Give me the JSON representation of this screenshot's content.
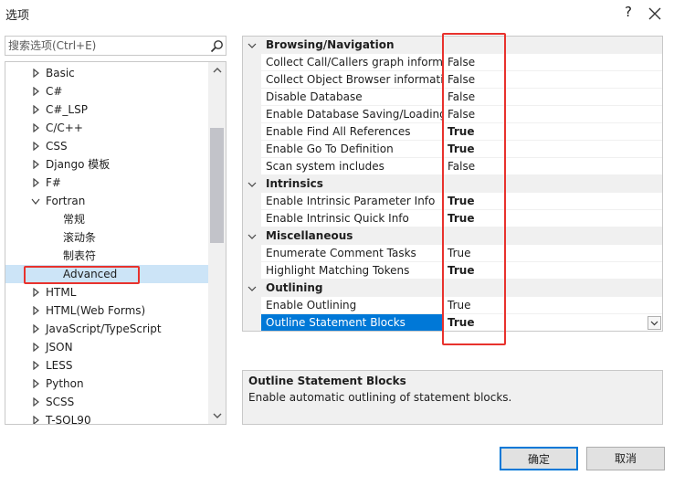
{
  "window": {
    "title": "选项",
    "help_label": "?"
  },
  "search": {
    "placeholder": "搜索选项(Ctrl+E)"
  },
  "tree": {
    "items": [
      {
        "label": "Basic",
        "expandable": true
      },
      {
        "label": "C#",
        "expandable": true
      },
      {
        "label": "C#_LSP",
        "expandable": true
      },
      {
        "label": "C/C++",
        "expandable": true
      },
      {
        "label": "CSS",
        "expandable": true
      },
      {
        "label": "Django 模板",
        "expandable": true
      },
      {
        "label": "F#",
        "expandable": true
      },
      {
        "label": "Fortran",
        "expandable": true,
        "expanded": true
      },
      {
        "label": "常规",
        "child": true
      },
      {
        "label": "滚动条",
        "child": true
      },
      {
        "label": "制表符",
        "child": true
      },
      {
        "label": "Advanced",
        "child": true,
        "selected": true
      },
      {
        "label": "HTML",
        "expandable": true
      },
      {
        "label": "HTML(Web Forms)",
        "expandable": true
      },
      {
        "label": "JavaScript/TypeScript",
        "expandable": true
      },
      {
        "label": "JSON",
        "expandable": true
      },
      {
        "label": "LESS",
        "expandable": true
      },
      {
        "label": "Python",
        "expandable": true
      },
      {
        "label": "SCSS",
        "expandable": true
      },
      {
        "label": "T-SQL90",
        "expandable": true
      }
    ]
  },
  "grid": {
    "categories": [
      {
        "label": "Browsing/Navigation",
        "props": [
          {
            "name": "Collect Call/Callers graph informa",
            "value": "False",
            "bold": false
          },
          {
            "name": "Collect Object Browser informatio",
            "value": "False",
            "bold": false
          },
          {
            "name": "Disable Database",
            "value": "False",
            "bold": false
          },
          {
            "name": "Enable Database Saving/Loading",
            "value": "False",
            "bold": false
          },
          {
            "name": "Enable Find All References",
            "value": "True",
            "bold": true
          },
          {
            "name": "Enable Go To Definition",
            "value": "True",
            "bold": true
          },
          {
            "name": "Scan system includes",
            "value": "False",
            "bold": false
          }
        ]
      },
      {
        "label": "Intrinsics",
        "props": [
          {
            "name": "Enable Intrinsic Parameter Info",
            "value": "True",
            "bold": true
          },
          {
            "name": "Enable Intrinsic Quick Info",
            "value": "True",
            "bold": true
          }
        ]
      },
      {
        "label": "Miscellaneous",
        "props": [
          {
            "name": "Enumerate Comment Tasks",
            "value": "True",
            "bold": false
          },
          {
            "name": "Highlight Matching Tokens",
            "value": "True",
            "bold": true
          }
        ]
      },
      {
        "label": "Outlining",
        "props": [
          {
            "name": "Enable Outlining",
            "value": "True",
            "bold": false
          },
          {
            "name": "Outline Statement Blocks",
            "value": "True",
            "bold": true,
            "selected": true
          }
        ]
      }
    ]
  },
  "description": {
    "title": "Outline Statement Blocks",
    "text": "Enable automatic outlining of statement blocks."
  },
  "buttons": {
    "ok_label": "确定",
    "cancel_label": "取消"
  },
  "colors": {
    "selection_blue": "#0078d7",
    "annotation_red": "#e8322d",
    "tree_selected": "#cce4f7"
  }
}
